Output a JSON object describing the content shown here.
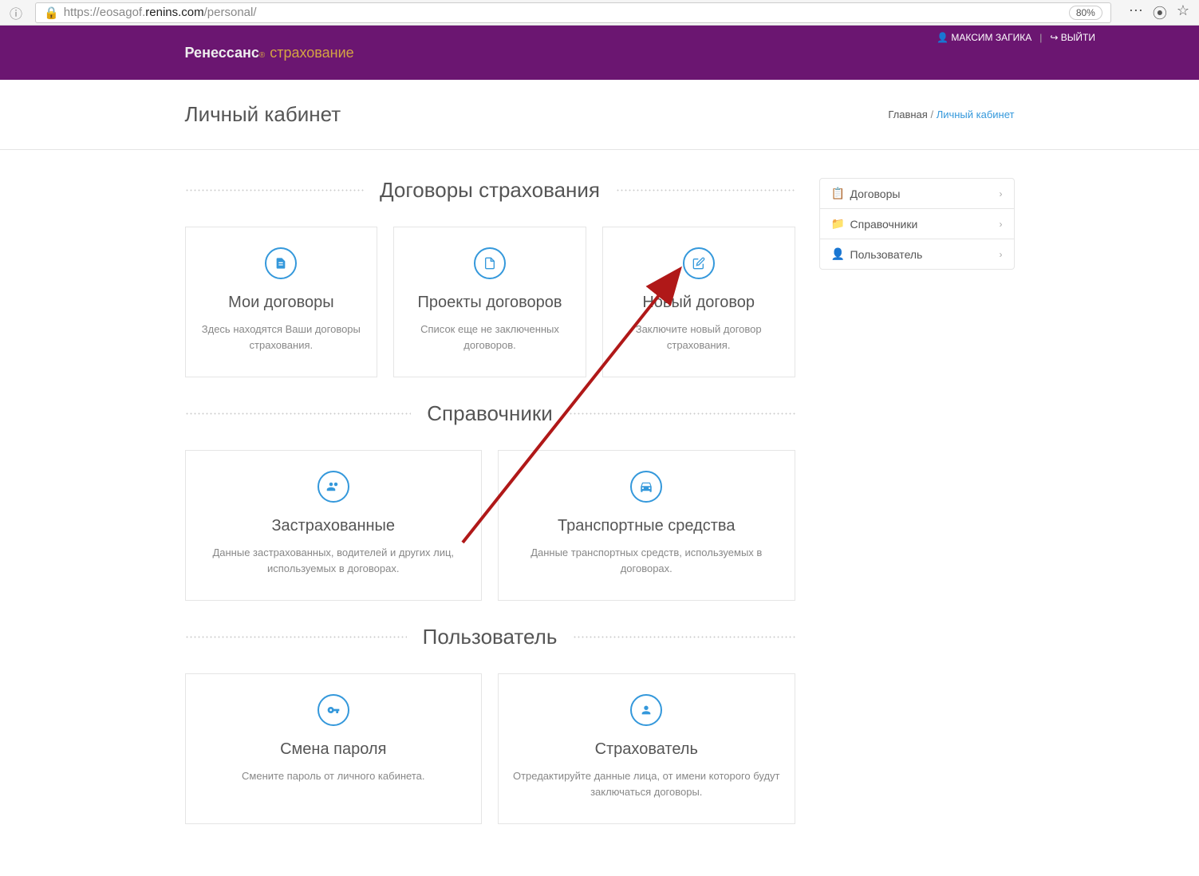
{
  "browser": {
    "url_prefix": "https://eosagof.",
    "url_domain": "renins.com",
    "url_path": "/personal/",
    "zoom": "80%"
  },
  "header": {
    "logo_main": "Ренессанс",
    "logo_sub": "страхование",
    "user_name": "МАКСИМ ЗАГИКА",
    "logout": "ВЫЙТИ"
  },
  "subheader": {
    "title": "Личный кабинет",
    "breadcrumb_home": "Главная",
    "breadcrumb_current": "Личный кабинет"
  },
  "sections": {
    "contracts": {
      "title": "Договоры страхования",
      "cards": [
        {
          "title": "Мои договоры",
          "desc": "Здесь находятся Ваши договоры страхования."
        },
        {
          "title": "Проекты договоров",
          "desc": "Список еще не заключенных договоров."
        },
        {
          "title": "Новый договор",
          "desc": "Заключите новый договор страхования."
        }
      ]
    },
    "directories": {
      "title": "Справочники",
      "cards": [
        {
          "title": "Застрахованные",
          "desc": "Данные застрахованных, водителей и других лиц, используемых в договорах."
        },
        {
          "title": "Транспортные средства",
          "desc": "Данные транспортных средств, используемых в договорах."
        }
      ]
    },
    "user": {
      "title": "Пользователь",
      "cards": [
        {
          "title": "Смена пароля",
          "desc": "Смените пароль от личного кабинета."
        },
        {
          "title": "Страхователь",
          "desc": "Отредактируйте данные лица, от имени которого будут заключаться договоры."
        }
      ]
    }
  },
  "sidebar": {
    "items": [
      {
        "label": "Договоры"
      },
      {
        "label": "Справочники"
      },
      {
        "label": "Пользователь"
      }
    ]
  }
}
